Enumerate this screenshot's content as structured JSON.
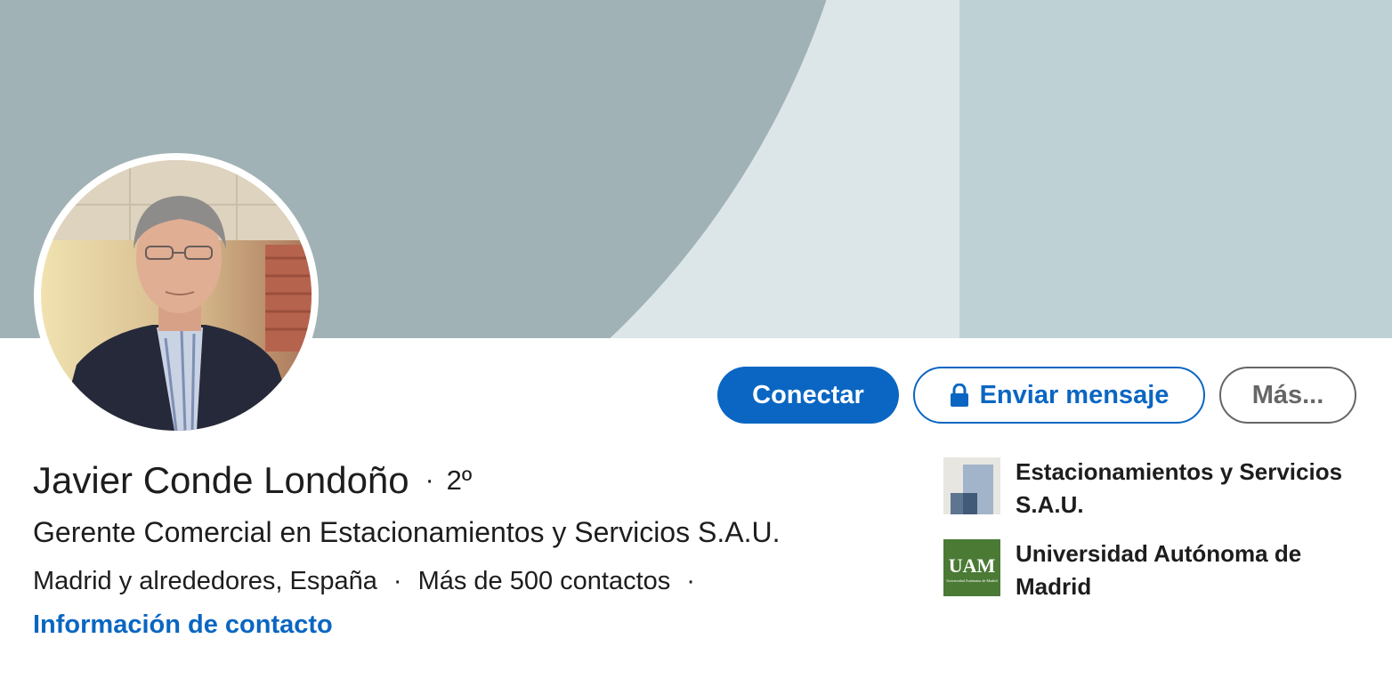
{
  "profile": {
    "name": "Javier Conde Londoño",
    "separator": "·",
    "degree": "2º",
    "headline": "Gerente Comercial en Estacionamientos y Servicios S.A.U.",
    "location": "Madrid y alrededores, España",
    "contacts": "Más de 500 contactos",
    "contact_info_link": "Información de contacto"
  },
  "actions": {
    "connect_label": "Conectar",
    "message_label": "Enviar mensaje",
    "more_label": "Más..."
  },
  "organizations": [
    {
      "name": "Estacionamientos y Servicios S.A.U.",
      "logo_icon": "company-logo-icon"
    },
    {
      "name": "Universidad Autónoma de Madrid",
      "logo_icon": "uam-logo-icon",
      "logo_text": "UAM",
      "logo_subtext": "Universidad Autónoma de Madrid"
    }
  ],
  "colors": {
    "primary": "#0a66c2",
    "banner_light": "#dce6e9",
    "banner_mid": "#bed2d6",
    "banner_dark": "#a0b2b6",
    "uam_green": "#4a7a34"
  }
}
